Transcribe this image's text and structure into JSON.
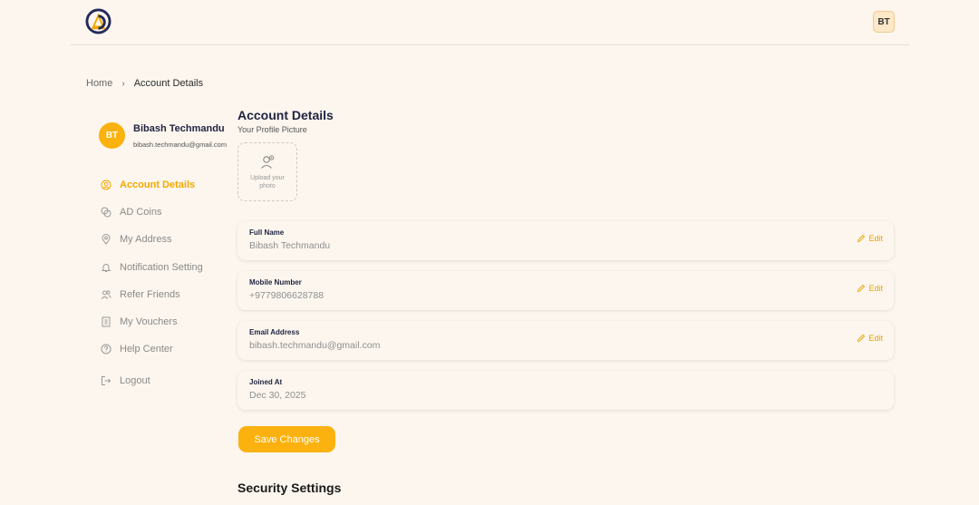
{
  "header": {
    "avatar_initials": "BT"
  },
  "breadcrumb": {
    "home": "Home",
    "separator": "›",
    "current": "Account Details"
  },
  "profile": {
    "initials": "BT",
    "name": "Bibash Techmandu",
    "email": "bibash.techmandu@gmail.com"
  },
  "sidebar": {
    "items": [
      {
        "label": "Account Details",
        "icon": "user-circle-icon",
        "active": true
      },
      {
        "label": "AD Coins",
        "icon": "coins-icon",
        "active": false
      },
      {
        "label": "My Address",
        "icon": "map-pin-icon",
        "active": false
      },
      {
        "label": "Notification Setting",
        "icon": "bell-icon",
        "active": false
      },
      {
        "label": "Refer Friends",
        "icon": "users-icon",
        "active": false
      },
      {
        "label": "My Vouchers",
        "icon": "voucher-icon",
        "active": false
      },
      {
        "label": "Help Center",
        "icon": "help-circle-icon",
        "active": false
      },
      {
        "label": "Logout",
        "icon": "logout-icon",
        "active": false
      }
    ]
  },
  "main": {
    "title": "Account Details",
    "subtitle": "Your Profile Picture",
    "upload_text": "Upload your photo",
    "fields": [
      {
        "label": "Full Name",
        "value": "Bibash Techmandu",
        "edit": "Edit"
      },
      {
        "label": "Mobile Number",
        "value": "+9779806628788",
        "edit": "Edit"
      },
      {
        "label": "Email Address",
        "value": "bibash.techmandu@gmail.com",
        "edit": "Edit"
      },
      {
        "label": "Joined At",
        "value": "Dec 30, 2025"
      }
    ],
    "save_label": "Save Changes",
    "security_title": "Security Settings"
  },
  "colors": {
    "background": "#fcf6ee",
    "accent": "#fbb10e",
    "title": "#1f2340"
  }
}
